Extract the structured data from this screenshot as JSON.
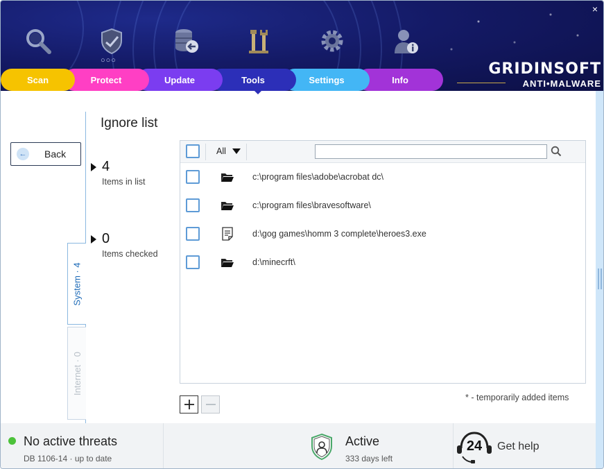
{
  "app": {
    "close_glyph": "×",
    "logo_main": "GRIDINSOFT",
    "logo_sub": "ANTI•MALWARE"
  },
  "header": {
    "icons": [
      "search-icon",
      "shield-icon",
      "database-update-icon",
      "tools-icon",
      "gear-icon",
      "user-info-icon"
    ],
    "more_dots": "○○○"
  },
  "nav": {
    "tabs": [
      {
        "label": "Scan",
        "color": "#f6c300"
      },
      {
        "label": "Protect",
        "color": "#ff3fc4"
      },
      {
        "label": "Update",
        "color": "#7b3df0"
      },
      {
        "label": "Tools",
        "color": "#2c2fb8",
        "active": true
      },
      {
        "label": "Settings",
        "color": "#43b6f5"
      },
      {
        "label": "Info",
        "color": "#a233d8"
      }
    ]
  },
  "sidebar": {
    "back_label": "Back",
    "tabs": [
      {
        "label": "System · 4",
        "active": true
      },
      {
        "label": "Internet · 0",
        "active": false
      }
    ]
  },
  "main": {
    "title": "Ignore list",
    "stats": {
      "items_in_list": {
        "value": "4",
        "label": "Items in list"
      },
      "items_checked": {
        "value": "0",
        "label": "Items checked"
      }
    },
    "filter": {
      "selected": "All"
    },
    "search": {
      "value": "",
      "placeholder": ""
    },
    "rows": [
      {
        "icon": "folder-icon",
        "path": "c:\\program files\\adobe\\acrobat dc\\"
      },
      {
        "icon": "folder-icon",
        "path": "c:\\program files\\bravesoftware\\"
      },
      {
        "icon": "file-icon",
        "path": "d:\\gog games\\homm 3 complete\\heroes3.exe"
      },
      {
        "icon": "folder-icon",
        "path": "d:\\minecrft\\"
      }
    ],
    "add_glyph": "+",
    "remove_glyph": "−",
    "note": "* - temporarily added items"
  },
  "footer": {
    "status_title": "No active threats",
    "status_sub": "DB 1106-14 · up to date",
    "license_title": "Active",
    "license_sub": "333 days left",
    "support_number": "24",
    "help_label": "Get help"
  },
  "colors": {
    "accent": "#2c2fb8",
    "checkbox_border": "#5e9bd6",
    "status_ok": "#4cc23a"
  }
}
